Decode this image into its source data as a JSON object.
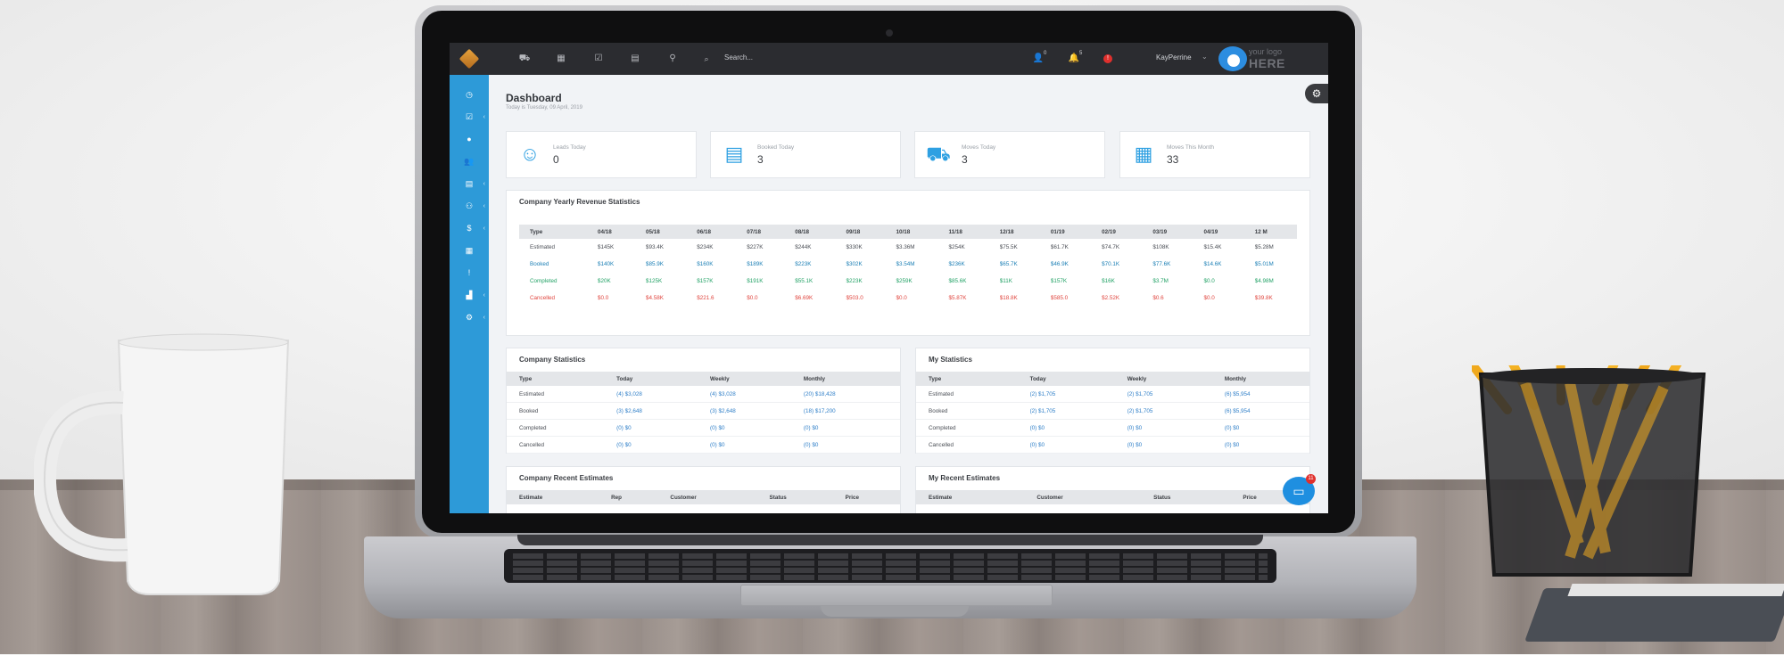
{
  "topbar": {
    "search_placeholder": "Search...",
    "contacts_count": "0",
    "notifications_count": "5",
    "alert_count": "!",
    "username": "KayPerrine",
    "brand_line1": "your logo",
    "brand_line2": "HERE"
  },
  "page": {
    "title": "Dashboard",
    "subtitle": "Today is Tuesday, 09 April, 2019"
  },
  "stats": [
    {
      "icon": "leads-icon",
      "label": "Leads Today",
      "value": "0"
    },
    {
      "icon": "booked-icon",
      "label": "Booked Today",
      "value": "3"
    },
    {
      "icon": "truck-icon",
      "label": "Moves Today",
      "value": "3"
    },
    {
      "icon": "calendar-icon",
      "label": "Moves This Month",
      "value": "33"
    }
  ],
  "revenue": {
    "title": "Company Yearly Revenue Statistics",
    "headers": [
      "Type",
      "04/18",
      "05/18",
      "06/18",
      "07/18",
      "08/18",
      "09/18",
      "10/18",
      "11/18",
      "12/18",
      "01/19",
      "02/19",
      "03/19",
      "04/19",
      "12 M"
    ],
    "rows": [
      {
        "type": "Estimated",
        "values": [
          "$145K",
          "$93.4K",
          "$234K",
          "$227K",
          "$244K",
          "$330K",
          "$3.36M",
          "$254K",
          "$75.5K",
          "$61.7K",
          "$74.7K",
          "$108K",
          "$15.4K",
          "$5.28M"
        ]
      },
      {
        "type": "Booked",
        "values": [
          "$140K",
          "$85.9K",
          "$160K",
          "$189K",
          "$223K",
          "$302K",
          "$3.54M",
          "$236K",
          "$65.7K",
          "$46.9K",
          "$70.1K",
          "$77.6K",
          "$14.6K",
          "$5.01M"
        ]
      },
      {
        "type": "Completed",
        "values": [
          "$20K",
          "$125K",
          "$157K",
          "$191K",
          "$55.1K",
          "$223K",
          "$259K",
          "$85.6K",
          "$11K",
          "$157K",
          "$16K",
          "$3.7M",
          "$0.0",
          "$4.98M"
        ]
      },
      {
        "type": "Cancelled",
        "values": [
          "$0.0",
          "$4.58K",
          "$221.6",
          "$0.0",
          "$6.69K",
          "$503.0",
          "$0.0",
          "$5.87K",
          "$18.8K",
          "$585.0",
          "$2.52K",
          "$0.6",
          "$0.0",
          "$39.8K"
        ]
      }
    ]
  },
  "company_stats": {
    "title": "Company Statistics",
    "headers": [
      "Type",
      "Today",
      "Weekly",
      "Monthly"
    ],
    "rows": [
      [
        "Estimated",
        "(4) $3,028",
        "(4) $3,028",
        "(20) $18,428"
      ],
      [
        "Booked",
        "(3) $2,648",
        "(3) $2,648",
        "(18) $17,200"
      ],
      [
        "Completed",
        "(0) $0",
        "(0) $0",
        "(0) $0"
      ],
      [
        "Cancelled",
        "(0) $0",
        "(0) $0",
        "(0) $0"
      ]
    ]
  },
  "my_stats": {
    "title": "My Statistics",
    "headers": [
      "Type",
      "Today",
      "Weekly",
      "Monthly"
    ],
    "rows": [
      [
        "Estimated",
        "(2) $1,705",
        "(2) $1,705",
        "(6) $5,954"
      ],
      [
        "Booked",
        "(2) $1,705",
        "(2) $1,705",
        "(6) $5,954"
      ],
      [
        "Completed",
        "(0) $0",
        "(0) $0",
        "(0) $0"
      ],
      [
        "Cancelled",
        "(0) $0",
        "(0) $0",
        "(0) $0"
      ]
    ]
  },
  "company_recent": {
    "title": "Company Recent Estimates",
    "headers": [
      "Estimate",
      "Rep",
      "Customer",
      "Status",
      "Price"
    ]
  },
  "my_recent": {
    "title": "My Recent Estimates",
    "headers": [
      "Estimate",
      "Customer",
      "Status",
      "Price"
    ]
  },
  "chat": {
    "badge": "11"
  },
  "colors": {
    "sidebar": "#2d9ad8",
    "topbar": "#2b2c30",
    "booked": "#1b7fb5",
    "completed": "#23a266",
    "cancelled": "#e0463f",
    "link": "#2f7fc8"
  }
}
